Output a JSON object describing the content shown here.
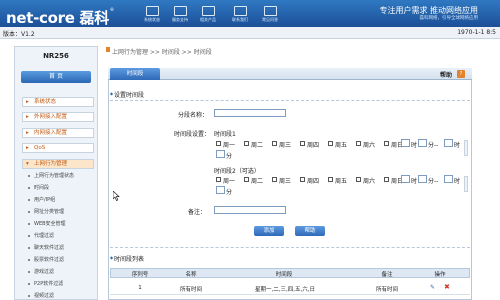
{
  "header": {
    "logo": "net-core 磊科",
    "logo_mark": "®",
    "nav": [
      {
        "label": "系统状态",
        "icon": "monitor-icon"
      },
      {
        "label": "服务支持",
        "icon": "headset-icon"
      },
      {
        "label": "相关产品",
        "icon": "box-icon"
      },
      {
        "label": "联系我们",
        "icon": "phone-icon"
      },
      {
        "label": "常见问答",
        "icon": "book-icon"
      }
    ],
    "slogan": "专注用户需求  推动网络应用",
    "slogan_sub": "磊科网络，引导全球网络应用"
  },
  "version_bar": {
    "version": "版本：V1.2",
    "datetime": "1970-1-1 8:5"
  },
  "sidebar": {
    "model": "NR256",
    "home": "首  页",
    "menu": [
      {
        "label": "系统状态",
        "active": false
      },
      {
        "label": "外网接入配置",
        "active": false
      },
      {
        "label": "内网接入配置",
        "active": false
      },
      {
        "label": "QoS",
        "active": false
      },
      {
        "label": "上网行为管理",
        "active": true
      }
    ],
    "submenu": [
      "上网行为管理状态",
      "时间段",
      "用户/IP组",
      "网址分类管理",
      "WEB安全管理",
      "代理过滤",
      "聊天软件过滤",
      "股票软件过滤",
      "游戏过滤",
      "P2P软件过滤",
      "视频过滤"
    ]
  },
  "main": {
    "breadcrumb": "上网行为管理 >> 时间段 >> 时间段",
    "tab": "时间段",
    "help": "帮助",
    "help_icon": "?",
    "section_set": "设置时间段",
    "name_label": "分段名称：",
    "name_value": "",
    "time_label": "时间段设置：",
    "slot1_label": "时间段1",
    "slot2_label": "时间段2（可选）",
    "days": [
      "周一",
      "周二",
      "周三",
      "周四",
      "周五",
      "周六",
      "周日"
    ],
    "hour_label": "时",
    "minute_label": "分",
    "dash": "--",
    "note_label": "备注：",
    "note_value": "",
    "add_button": "添加",
    "help_button": "帮助",
    "section_list": "时间段列表",
    "table": {
      "headers": [
        "序列号",
        "名称",
        "时间段",
        "备注",
        "操作"
      ],
      "rows": [
        {
          "index": "1",
          "name": "所有时间",
          "period": "星期一,二,三,四,五,六,日",
          "note": "所有时间",
          "edit_icon": "✎",
          "delete_icon": "✖"
        }
      ]
    }
  }
}
